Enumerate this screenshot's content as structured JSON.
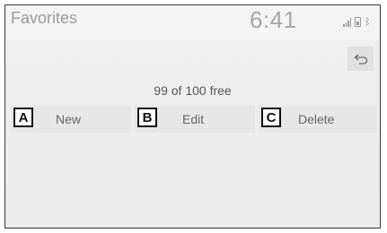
{
  "header": {
    "title": "Favorites",
    "clock": "6:41",
    "status_icons": [
      "signal-icon",
      "battery-icon",
      "bluetooth-icon"
    ],
    "bluetooth_glyph": "ᛒ"
  },
  "back_button": {
    "icon": "back-arrow-icon"
  },
  "storage": {
    "free_text": "99 of 100 free"
  },
  "actions": [
    {
      "marker": "A",
      "label": "New"
    },
    {
      "marker": "B",
      "label": "Edit"
    },
    {
      "marker": "C",
      "label": "Delete"
    }
  ],
  "colors": {
    "screen_background": "#ececec",
    "header_text": "#9a9a9a",
    "button_background": "#e7e7e7",
    "marker_border": "#111111"
  }
}
